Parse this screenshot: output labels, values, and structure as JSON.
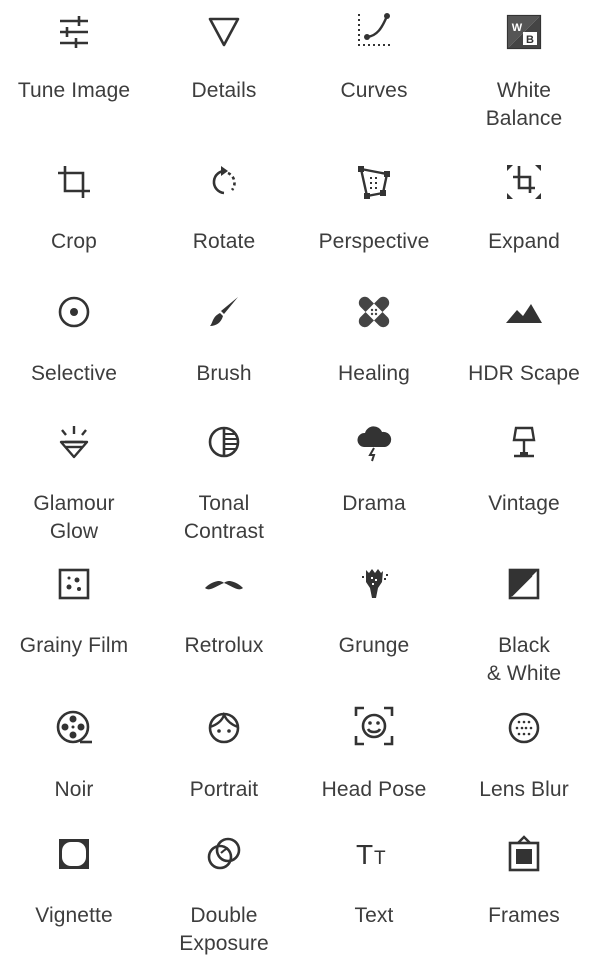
{
  "tools": [
    {
      "label": "Tune Image",
      "icon": "tune-image-icon"
    },
    {
      "label": "Details",
      "icon": "details-icon"
    },
    {
      "label": "Curves",
      "icon": "curves-icon"
    },
    {
      "label": "White\nBalance",
      "icon": "white-balance-icon"
    },
    {
      "label": "Crop",
      "icon": "crop-icon"
    },
    {
      "label": "Rotate",
      "icon": "rotate-icon"
    },
    {
      "label": "Perspective",
      "icon": "perspective-icon"
    },
    {
      "label": "Expand",
      "icon": "expand-icon"
    },
    {
      "label": "Selective",
      "icon": "selective-icon"
    },
    {
      "label": "Brush",
      "icon": "brush-icon"
    },
    {
      "label": "Healing",
      "icon": "healing-icon"
    },
    {
      "label": "HDR Scape",
      "icon": "hdr-scape-icon"
    },
    {
      "label": "Glamour\nGlow",
      "icon": "glamour-glow-icon"
    },
    {
      "label": "Tonal\nContrast",
      "icon": "tonal-contrast-icon"
    },
    {
      "label": "Drama",
      "icon": "drama-icon"
    },
    {
      "label": "Vintage",
      "icon": "vintage-icon"
    },
    {
      "label": "Grainy Film",
      "icon": "grainy-film-icon"
    },
    {
      "label": "Retrolux",
      "icon": "retrolux-icon"
    },
    {
      "label": "Grunge",
      "icon": "grunge-icon"
    },
    {
      "label": "Black\n& White",
      "icon": "black-and-white-icon"
    },
    {
      "label": "Noir",
      "icon": "noir-icon"
    },
    {
      "label": "Portrait",
      "icon": "portrait-icon"
    },
    {
      "label": "Head Pose",
      "icon": "head-pose-icon"
    },
    {
      "label": "Lens Blur",
      "icon": "lens-blur-icon"
    },
    {
      "label": "Vignette",
      "icon": "vignette-icon"
    },
    {
      "label": "Double\nExposure",
      "icon": "double-exposure-icon"
    },
    {
      "label": "Text",
      "icon": "text-icon"
    },
    {
      "label": "Frames",
      "icon": "frames-icon"
    }
  ],
  "icon_text": {
    "white_balance_w": "W",
    "white_balance_b": "B",
    "text_glyph_big": "T",
    "text_glyph_small": "T"
  }
}
